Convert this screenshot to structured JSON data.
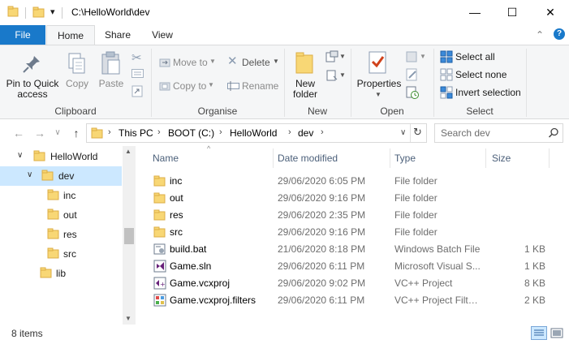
{
  "window": {
    "title": "C:\\HelloWorld\\dev",
    "controls": {
      "minimize": "—",
      "maximize": "☐",
      "close": "✕"
    }
  },
  "quick_access": {
    "dropdown": "▾"
  },
  "ribbon_tabs": [
    {
      "label": "File"
    },
    {
      "label": "Home"
    },
    {
      "label": "Share"
    },
    {
      "label": "View"
    }
  ],
  "ribbon_extras": {
    "collapse": "⌃",
    "help": "?"
  },
  "ribbon": {
    "clipboard": {
      "label": "Clipboard",
      "pin": "Pin to Quick access",
      "copy": "Copy",
      "paste": "Paste"
    },
    "organise": {
      "label": "Organise",
      "move_to": "Move to",
      "copy_to": "Copy to",
      "delete": "Delete",
      "rename": "Rename"
    },
    "new": {
      "label": "New",
      "new_folder": "New folder"
    },
    "open": {
      "label": "Open",
      "properties": "Properties"
    },
    "select": {
      "label": "Select",
      "select_all": "Select all",
      "select_none": "Select none",
      "invert_selection": "Invert selection"
    }
  },
  "nav": {
    "back": "←",
    "forward": "→",
    "recent": "∨",
    "up": "↑"
  },
  "breadcrumb": [
    "This PC",
    "BOOT (C:)",
    "HelloWorld",
    "dev"
  ],
  "search": {
    "placeholder": "Search dev"
  },
  "tree": [
    {
      "label": "HelloWorld",
      "level": 0,
      "expanded": true
    },
    {
      "label": "dev",
      "level": 1,
      "expanded": true,
      "selected": true
    },
    {
      "label": "inc",
      "level": 2
    },
    {
      "label": "out",
      "level": 2
    },
    {
      "label": "res",
      "level": 2
    },
    {
      "label": "src",
      "level": 2
    },
    {
      "label": "lib",
      "level": 1
    }
  ],
  "columns": {
    "name": "Name",
    "date": "Date modified",
    "type": "Type",
    "size": "Size"
  },
  "files": [
    {
      "name": "inc",
      "date": "29/06/2020 6:05 PM",
      "type": "File folder",
      "size": "",
      "icon": "folder-icon"
    },
    {
      "name": "out",
      "date": "29/06/2020 9:16 PM",
      "type": "File folder",
      "size": "",
      "icon": "folder-icon"
    },
    {
      "name": "res",
      "date": "29/06/2020 2:35 PM",
      "type": "File folder",
      "size": "",
      "icon": "folder-icon"
    },
    {
      "name": "src",
      "date": "29/06/2020 9:16 PM",
      "type": "File folder",
      "size": "",
      "icon": "folder-icon"
    },
    {
      "name": "build.bat",
      "date": "21/06/2020 8:18 PM",
      "type": "Windows Batch File",
      "size": "1 KB",
      "icon": "batch-file-icon"
    },
    {
      "name": "Game.sln",
      "date": "29/06/2020 6:11 PM",
      "type": "Microsoft Visual S...",
      "size": "1 KB",
      "icon": "visual-studio-solution-icon"
    },
    {
      "name": "Game.vcxproj",
      "date": "29/06/2020 9:02 PM",
      "type": "VC++ Project",
      "size": "8 KB",
      "icon": "vcxproj-icon"
    },
    {
      "name": "Game.vcxproj.filters",
      "date": "29/06/2020 6:11 PM",
      "type": "VC++ Project Filte...",
      "size": "2 KB",
      "icon": "filters-file-icon"
    }
  ],
  "status": {
    "items": "8 items"
  },
  "colors": {
    "file_tab": "#1979ca",
    "selection": "#cce8ff",
    "folder": "#f8d775"
  }
}
